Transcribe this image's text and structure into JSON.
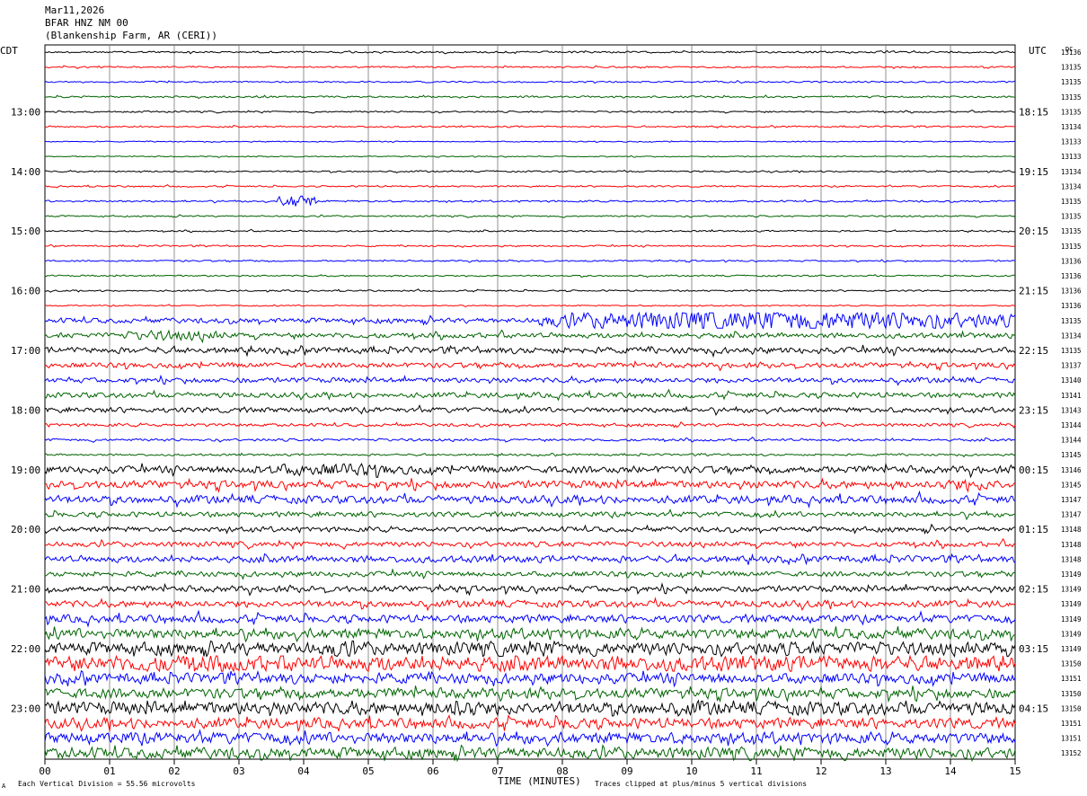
{
  "header": {
    "date": "Mar11,2026",
    "station": "BFAR HNZ NM 00",
    "location": "(Blankenship Farm, AR (CERI))"
  },
  "chart_data": {
    "type": "line",
    "title": "",
    "left_axis_label": "CDT",
    "right_axis_label": "UTC",
    "dc_label": "DC",
    "xlabel": "TIME (MINUTES)",
    "xlim": [
      0,
      15
    ],
    "x_ticks": [
      "00",
      "01",
      "02",
      "03",
      "04",
      "05",
      "06",
      "07",
      "08",
      "09",
      "10",
      "11",
      "12",
      "13",
      "14",
      "15"
    ],
    "grid_vertical": true,
    "trace_count": 48,
    "trace_colors": [
      "#000000",
      "#ff0000",
      "#0000ff",
      "#006400"
    ],
    "left_hour_labels": [
      {
        "trace": 4,
        "label": "13:00"
      },
      {
        "trace": 8,
        "label": "14:00"
      },
      {
        "trace": 12,
        "label": "15:00"
      },
      {
        "trace": 16,
        "label": "16:00"
      },
      {
        "trace": 20,
        "label": "17:00"
      },
      {
        "trace": 24,
        "label": "18:00"
      },
      {
        "trace": 28,
        "label": "19:00"
      },
      {
        "trace": 32,
        "label": "20:00"
      },
      {
        "trace": 36,
        "label": "21:00"
      },
      {
        "trace": 40,
        "label": "22:00"
      },
      {
        "trace": 44,
        "label": "23:00"
      }
    ],
    "right_hour_labels": [
      {
        "trace": 4,
        "label": "18:15"
      },
      {
        "trace": 8,
        "label": "19:15"
      },
      {
        "trace": 12,
        "label": "20:15"
      },
      {
        "trace": 16,
        "label": "21:15"
      },
      {
        "trace": 20,
        "label": "22:15"
      },
      {
        "trace": 24,
        "label": "23:15"
      },
      {
        "trace": 28,
        "label": "00:15"
      },
      {
        "trace": 32,
        "label": "01:15"
      },
      {
        "trace": 36,
        "label": "02:15"
      },
      {
        "trace": 40,
        "label": "03:15"
      },
      {
        "trace": 44,
        "label": "04:15"
      }
    ],
    "dc_values": [
      "13136",
      "13135",
      "13135",
      "13135",
      "13135",
      "13134",
      "13133",
      "13133",
      "13134",
      "13134",
      "13135",
      "13135",
      "13135",
      "13135",
      "13136",
      "13136",
      "13136",
      "13136",
      "13135",
      "13134",
      "13135",
      "13137",
      "13140",
      "13141",
      "13143",
      "13144",
      "13144",
      "13145",
      "13146",
      "13145",
      "13147",
      "13147",
      "13148",
      "13148",
      "13148",
      "13149",
      "13149",
      "13149",
      "13149",
      "13149",
      "13149",
      "13150",
      "13151",
      "13150",
      "13150",
      "13151",
      "13151",
      "13152"
    ],
    "trace_amplitudes": [
      0.35,
      0.3,
      0.3,
      0.35,
      0.3,
      0.3,
      0.2,
      0.2,
      0.3,
      0.3,
      0.35,
      0.3,
      0.3,
      0.3,
      0.3,
      0.3,
      0.3,
      0.25,
      1.0,
      1.0,
      1.2,
      1.0,
      1.0,
      1.0,
      1.0,
      0.6,
      0.5,
      0.4,
      1.4,
      1.5,
      1.5,
      1.0,
      1.0,
      1.0,
      1.3,
      1.0,
      1.2,
      1.3,
      1.5,
      2.0,
      2.5,
      3.0,
      2.0,
      2.0,
      2.5,
      2.0,
      2.2,
      2.2
    ],
    "events": [
      {
        "trace": 10,
        "start": 3.6,
        "end": 4.2,
        "amp": 3.0
      },
      {
        "trace": 18,
        "start": 7.6,
        "end": 15.0,
        "amp": 4.5
      },
      {
        "trace": 19,
        "start": 1.0,
        "end": 3.0,
        "amp": 2.0
      },
      {
        "trace": 28,
        "start": 2.8,
        "end": 6.0,
        "amp": 2.5
      },
      {
        "trace": 29,
        "start": 13.5,
        "end": 15.0,
        "amp": 2.5
      },
      {
        "trace": 40,
        "start": 4.3,
        "end": 4.9,
        "amp": 4.0
      },
      {
        "trace": 40,
        "start": 6.3,
        "end": 8.8,
        "amp": 3.0
      },
      {
        "trace": 41,
        "start": 0.0,
        "end": 4.5,
        "amp": 3.5
      },
      {
        "trace": 41,
        "start": 6.0,
        "end": 8.0,
        "amp": 3.0
      },
      {
        "trace": 44,
        "start": 6.1,
        "end": 6.8,
        "amp": 4.5
      },
      {
        "trace": 44,
        "start": 9.5,
        "end": 10.5,
        "amp": 3.0
      },
      {
        "trace": 45,
        "start": 7.9,
        "end": 8.3,
        "amp": 3.0
      }
    ]
  },
  "footer": {
    "vertical_division": "Each Vertical Division =   55.56 microvolts",
    "clip_note": "Traces clipped at plus/minus 5 vertical divisions",
    "corner_mark": "A"
  }
}
